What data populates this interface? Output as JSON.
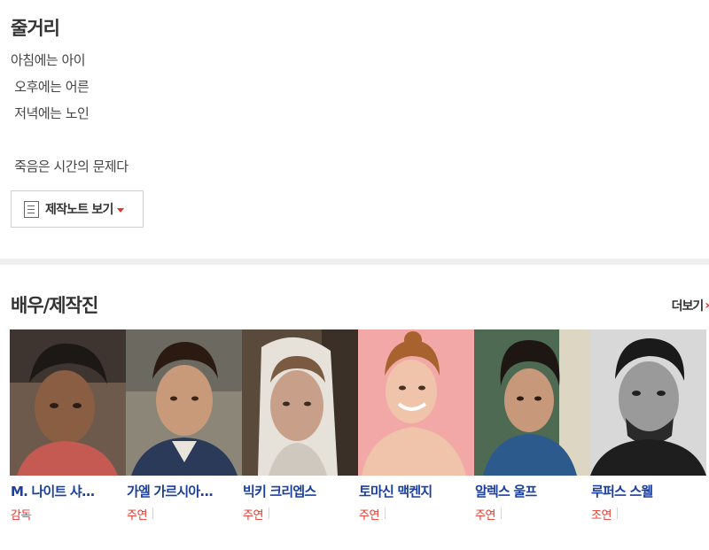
{
  "synopsis": {
    "title": "줄거리",
    "lines": [
      "아침에는 아이",
      " 오후에는 어른",
      " 저녁에는 노인",
      "",
      " 죽음은 시간의 문제다"
    ],
    "notes_button_label": "제작노트 보기"
  },
  "cast": {
    "title": "배우/제작진",
    "more_label": "더보기",
    "members": [
      {
        "name": "M. 나이트 샤...",
        "role": "감독"
      },
      {
        "name": "가엘 가르시아...",
        "role": "주연"
      },
      {
        "name": "빅키 크리엡스",
        "role": "주연"
      },
      {
        "name": "토마신 맥켄지",
        "role": "주연"
      },
      {
        "name": "알렉스 울프",
        "role": "주연"
      },
      {
        "name": "루퍼스 스웰",
        "role": "조연"
      }
    ]
  },
  "colors": {
    "accent_red": "#e8342a",
    "name_blue": "#1a3fa0",
    "divider": "#f0f0f0"
  }
}
